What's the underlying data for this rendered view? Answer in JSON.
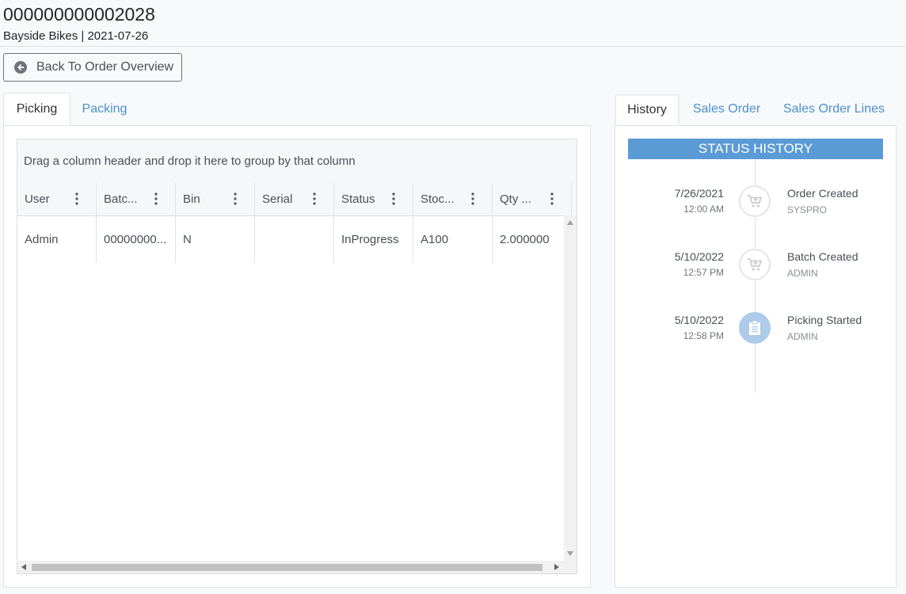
{
  "header": {
    "order_number": "000000000002028",
    "subtitle": "Bayside Bikes | 2021-07-26"
  },
  "back_button": {
    "label": "Back To Order Overview",
    "icon": "arrow-circle-left-icon"
  },
  "left_tabs": [
    {
      "label": "Picking",
      "active": true
    },
    {
      "label": "Packing",
      "active": false
    }
  ],
  "grid": {
    "group_hint": "Drag a column header and drop it here to group by that column",
    "columns": [
      "User",
      "Batc...",
      "Bin",
      "Serial",
      "Status",
      "Stoc...",
      "Qty ..."
    ],
    "rows": [
      [
        "Admin",
        "00000000...",
        "N",
        "",
        "InProgress",
        "A100",
        "2.000000"
      ]
    ]
  },
  "right_tabs": [
    {
      "label": "History",
      "active": true
    },
    {
      "label": "Sales Order",
      "active": false
    },
    {
      "label": "Sales Order Lines",
      "active": false
    }
  ],
  "status_history": {
    "title": "STATUS HISTORY",
    "events": [
      {
        "date": "7/26/2021",
        "time": "12:00 AM",
        "title": "Order Created",
        "user": "SYSPRO",
        "icon": "cart-icon",
        "done": false
      },
      {
        "date": "5/10/2022",
        "time": "12:57 PM",
        "title": "Batch Created",
        "user": "ADMIN",
        "icon": "cart-icon",
        "done": false
      },
      {
        "date": "5/10/2022",
        "time": "12:58 PM",
        "title": "Picking Started",
        "user": "ADMIN",
        "icon": "clipboard-list-icon",
        "done": true
      }
    ]
  },
  "colors": {
    "accent": "#5b9bd5",
    "link": "#4a90cf",
    "done_circle": "#aecbea"
  }
}
